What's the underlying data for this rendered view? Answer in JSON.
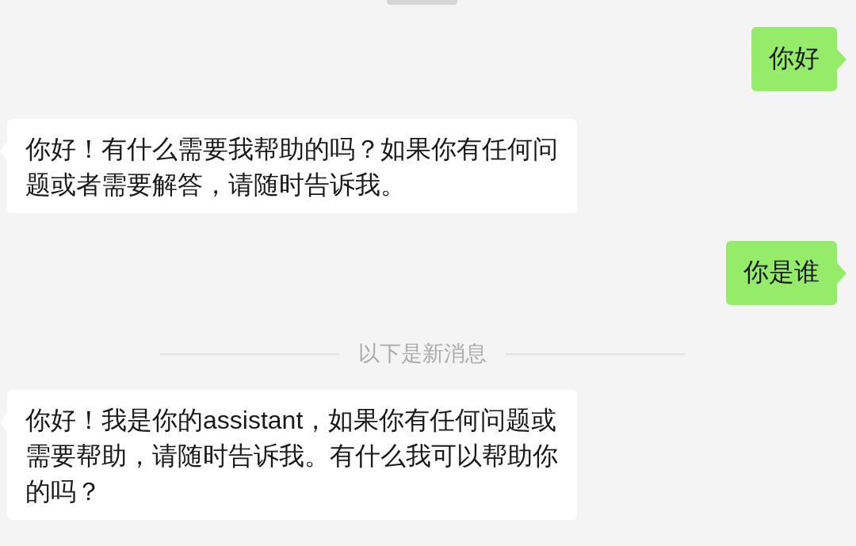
{
  "chat": {
    "items": [
      {
        "kind": "sent",
        "text": "你好"
      },
      {
        "kind": "received",
        "text": "你好！有什么需要我帮助的吗？如果你有任何问题或者需要解答，请随时告诉我。"
      },
      {
        "kind": "sent",
        "text": "你是谁"
      },
      {
        "kind": "notice",
        "text": "以下是新消息"
      },
      {
        "kind": "received",
        "text": "你好！我是你的assistant，如果你有任何问题或需要帮助，请随时告诉我。有什么我可以帮助你的吗？"
      }
    ]
  }
}
